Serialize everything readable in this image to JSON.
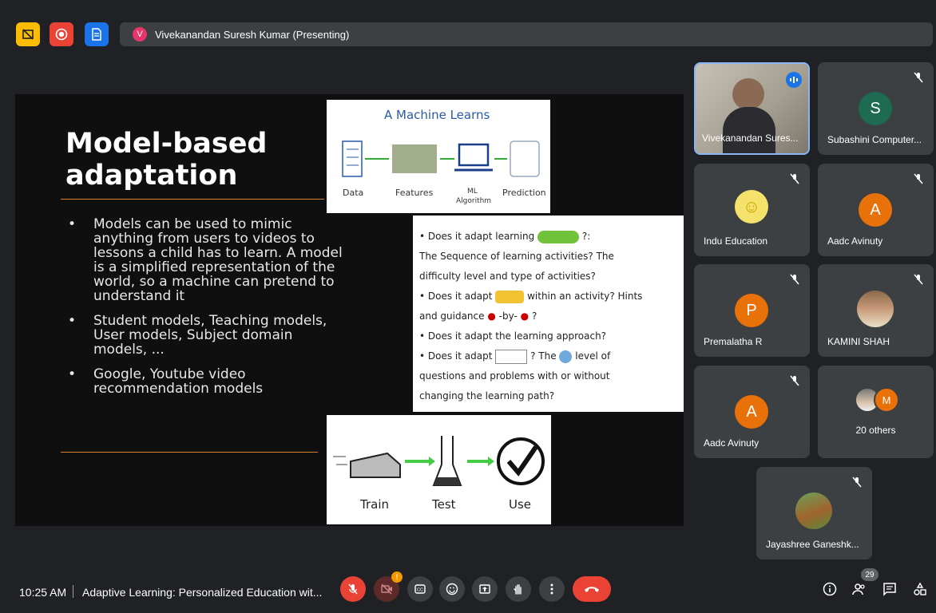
{
  "topbar": {
    "presenter_initial": "V",
    "presenting_text": "Vivekanandan Suresh Kumar (Presenting)",
    "icons": [
      "slide-off-icon",
      "record-icon",
      "document-icon"
    ]
  },
  "slide": {
    "title_line1": "Model-based",
    "title_line2": "adaptation",
    "bullets": [
      "Models can be used to mimic anything from users to videos to lessons a child has to learn. A model is a simplified representation of the world, so a machine can pretend to understand it",
      "Student models, Teaching models, User models, Subject domain models, ...",
      "Google, Youtube video recommendation models"
    ],
    "card1": {
      "title": "A Machine Learns",
      "labels": [
        "Data",
        "Features",
        "ML",
        "Algorithm",
        "Prediction"
      ]
    },
    "card2": {
      "lines": [
        "• Does it adapt learning",
        "?:",
        "The Sequence of learning activities? The",
        "difficulty level and type of activities?",
        "• Does it adapt",
        "within an activity? Hints",
        "and guidance",
        "-by-",
        "?",
        "• Does it adapt the learning approach?",
        "• Does it adapt",
        "? The",
        "level of",
        "questions and problems with or without",
        "changing the learning path?"
      ]
    },
    "card3": {
      "labels": [
        "Train",
        "Test",
        "Use"
      ]
    }
  },
  "participants": [
    {
      "name": "Vivekanandan Sures...",
      "type": "video",
      "speaking": true
    },
    {
      "name": "Subashini Computer...",
      "initial": "S",
      "color": "#1e6b52",
      "muted": true
    },
    {
      "name": "Indu Education",
      "type": "photo",
      "muted": true
    },
    {
      "name": "Aadc Avinuty",
      "initial": "A",
      "color": "#e8710a",
      "muted": true
    },
    {
      "name": "Premalatha R",
      "initial": "P",
      "color": "#e8710a",
      "muted": true
    },
    {
      "name": "KAMINI SHAH",
      "type": "photo",
      "muted": true
    },
    {
      "name": "Aadc Avinuty",
      "initial": "A",
      "color": "#e8710a",
      "muted": true
    },
    {
      "name": "20 others",
      "initial": "M",
      "color": "#e8710a"
    },
    {
      "name": "Jayashree Ganeshk...",
      "type": "photo",
      "muted": true
    }
  ],
  "bottombar": {
    "time": "10:25 AM",
    "meeting_title": "Adaptive Learning: Personalized Education wit...",
    "participant_count": "29",
    "colors": {
      "danger": "#ea4335",
      "control_bg": "#3c4043"
    }
  }
}
